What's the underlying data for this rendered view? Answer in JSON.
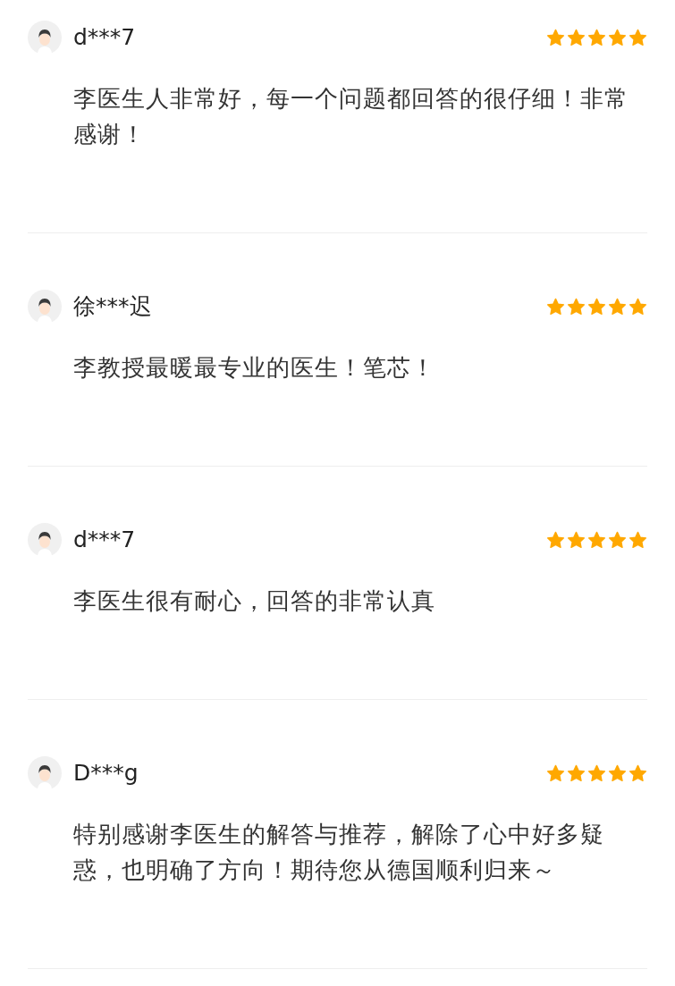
{
  "reviews": [
    {
      "user": "d***7",
      "stars": 5,
      "comment": "李医生人非常好，每一个问题都回答的很仔细！非常感谢！"
    },
    {
      "user": "徐***迟",
      "stars": 5,
      "comment": "李教授最暖最专业的医生！笔芯！"
    },
    {
      "user": "d***7",
      "stars": 5,
      "comment": "李医生很有耐心，回答的非常认真"
    },
    {
      "user": "D***g",
      "stars": 5,
      "comment": "特别感谢李医生的解答与推荐，解除了心中好多疑惑，也明确了方向！期待您从德国顺利归来～"
    }
  ]
}
